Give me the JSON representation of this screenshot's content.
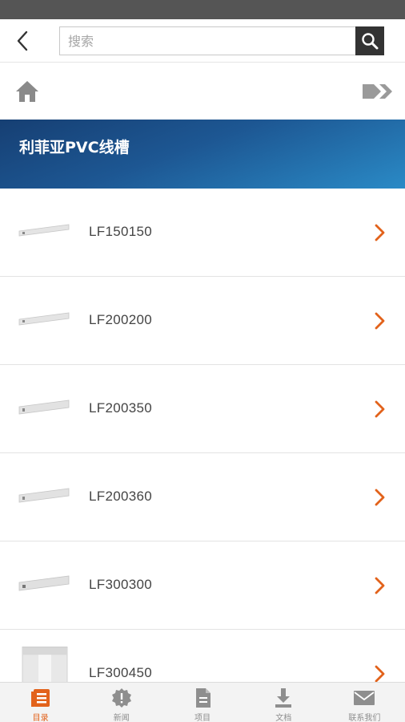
{
  "search": {
    "placeholder": "搜索"
  },
  "category": {
    "title": "利菲亚PVC线槽"
  },
  "products": [
    {
      "name": "LF150150"
    },
    {
      "name": "LF200200"
    },
    {
      "name": "LF200350"
    },
    {
      "name": "LF200360"
    },
    {
      "name": "LF300300"
    },
    {
      "name": "LF300450"
    }
  ],
  "tabs": [
    {
      "label": "目录",
      "icon": "catalog-icon",
      "active": true
    },
    {
      "label": "新闻",
      "icon": "news-icon",
      "active": false
    },
    {
      "label": "项目",
      "icon": "project-icon",
      "active": false
    },
    {
      "label": "文档",
      "icon": "download-icon",
      "active": false
    },
    {
      "label": "联系我们",
      "icon": "mail-icon",
      "active": false
    }
  ],
  "colors": {
    "accent": "#e2621b",
    "banner_start": "#163f73",
    "banner_end": "#2a8ac6",
    "status_bar": "#555555",
    "search_button": "#333333"
  }
}
